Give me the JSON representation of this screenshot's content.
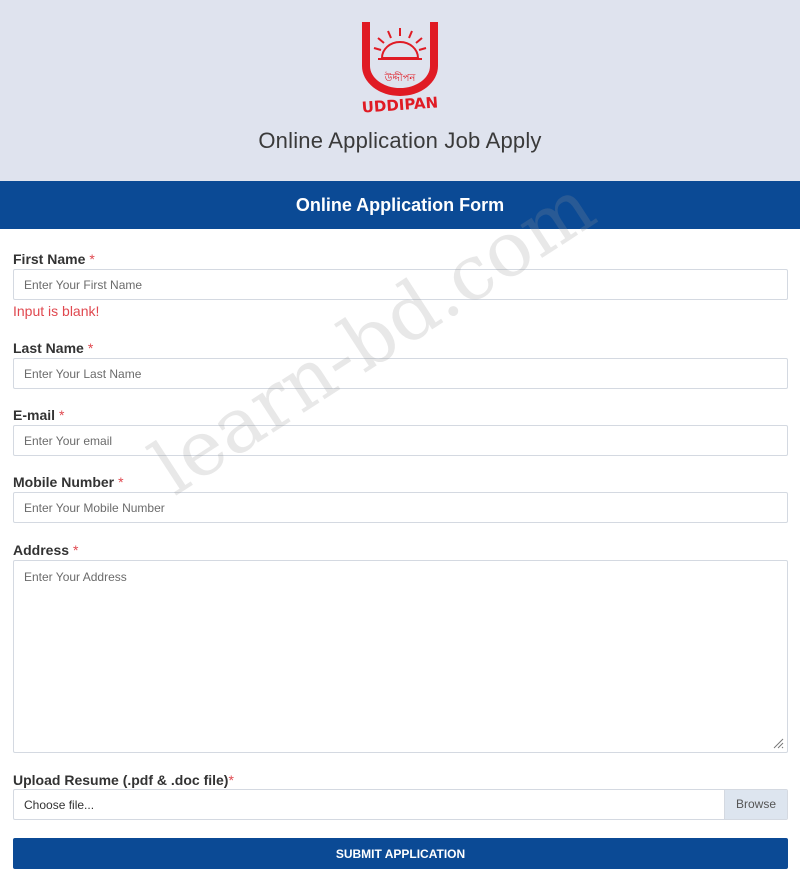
{
  "header": {
    "logo": {
      "text": "UDDIPAN",
      "bengali_text": "উদ্দীপন",
      "color": "#e01b24"
    },
    "page_title": "Online Application Job Apply"
  },
  "form": {
    "banner_title": "Online Application Form",
    "required_mark": "*",
    "fields": {
      "first_name": {
        "label": "First Name",
        "placeholder": "Enter Your First Name",
        "value": ""
      },
      "last_name": {
        "label": "Last Name",
        "placeholder": "Enter Your Last Name",
        "value": ""
      },
      "email": {
        "label": "E-mail",
        "placeholder": "Enter Your email",
        "value": ""
      },
      "mobile": {
        "label": "Mobile Number",
        "placeholder": "Enter Your Mobile Number",
        "value": ""
      },
      "address": {
        "label": "Address",
        "placeholder": "Enter Your Address",
        "value": ""
      }
    },
    "error_first_name": "Input is blank!",
    "upload": {
      "label": "Upload Resume (.pdf & .doc file)",
      "file_text": "Choose file...",
      "browse_label": "Browse"
    },
    "submit_label": "SUBMIT APPLICATION"
  },
  "watermark": "learn-bd.com",
  "colors": {
    "header_bg": "#dfe3ee",
    "accent_blue": "#0b4a95",
    "error_red": "#e0484f"
  }
}
